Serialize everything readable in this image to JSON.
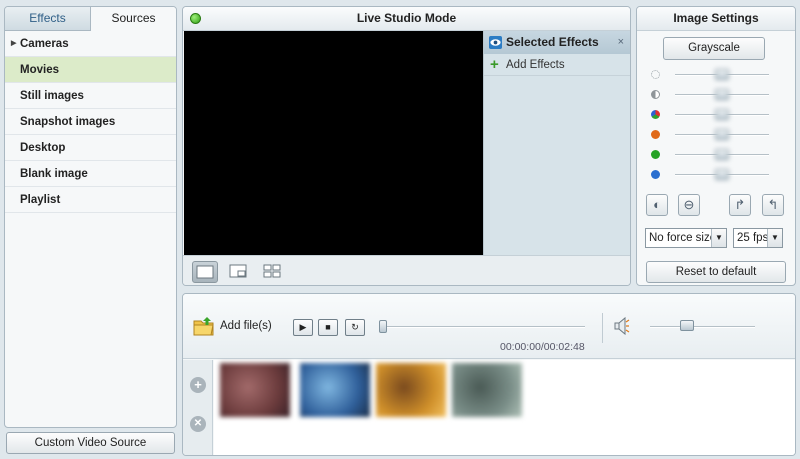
{
  "left_panel": {
    "tabs": [
      {
        "label": "Effects"
      },
      {
        "label": "Sources"
      }
    ],
    "sources": [
      {
        "label": "Cameras",
        "expandable": true
      },
      {
        "label": "Movies",
        "selected": true
      },
      {
        "label": "Still images"
      },
      {
        "label": "Snapshot images"
      },
      {
        "label": "Desktop"
      },
      {
        "label": "Blank image"
      },
      {
        "label": "Playlist"
      }
    ],
    "custom_video_source_label": "Custom Video Source"
  },
  "live": {
    "title": "Live Studio Mode",
    "selected_effects_title": "Selected Effects",
    "close_glyph": "×",
    "add_effects_label": "Add Effects",
    "add_glyph": "+"
  },
  "image_settings": {
    "title": "Image Settings",
    "grayscale_label": "Grayscale",
    "sliders": [
      {
        "name": "brightness",
        "icon": "sun-icon",
        "color": "#9aa3a8",
        "level": 0.5
      },
      {
        "name": "contrast",
        "icon": "contrast-icon",
        "color": "#8f9599",
        "level": 0.5
      },
      {
        "name": "saturation",
        "icon": "rgb-icon",
        "color": "#c23b8f",
        "level": 0.5
      },
      {
        "name": "red",
        "icon": "red-dot-icon",
        "color": "#e06a1a",
        "level": 0.5
      },
      {
        "name": "green",
        "icon": "green-dot-icon",
        "color": "#27a327",
        "level": 0.5
      },
      {
        "name": "blue",
        "icon": "blue-dot-icon",
        "color": "#2a6fd0",
        "level": 0.5
      }
    ],
    "resize_select": "No force size",
    "fps_select": "25 fps",
    "reset_label": "Reset to default"
  },
  "player": {
    "add_files_label": "Add file(s)",
    "time": "00:00:00/00:02:48",
    "seek_progress": 0,
    "volume_level": 0.35,
    "play_glyph": "▶",
    "stop_glyph": "■",
    "repeat_glyph": "↻"
  },
  "playlist": {
    "add_glyph": "+",
    "remove_glyph": "✕",
    "thumbnails": [
      {
        "colors": [
          "#6b3b3c",
          "#a26a6a",
          "#3a2228"
        ]
      },
      {
        "colors": [
          "#2f5f9a",
          "#7fb6e0",
          "#1b2f4a"
        ]
      },
      {
        "colors": [
          "#d0902a",
          "#7a4a1e",
          "#f2c060"
        ]
      },
      {
        "colors": [
          "#7a8e88",
          "#4a5a55",
          "#b0c2b8"
        ]
      }
    ]
  }
}
